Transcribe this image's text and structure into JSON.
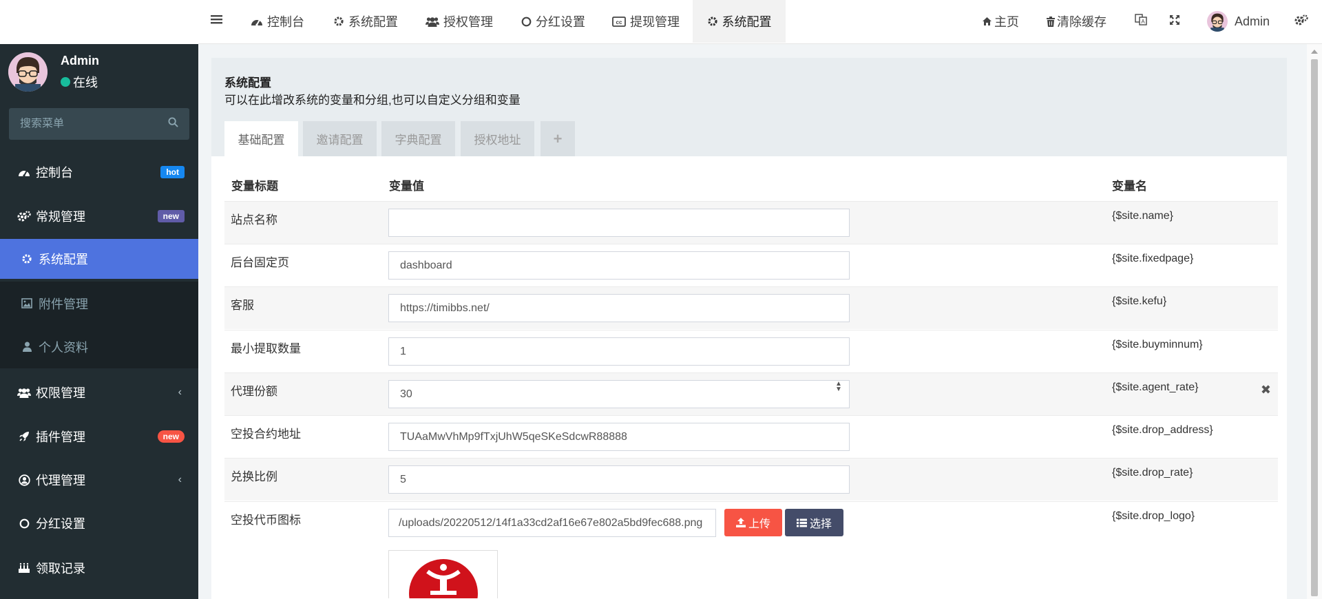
{
  "sidebar": {
    "user": {
      "name": "Admin",
      "status": "在线"
    },
    "search_placeholder": "搜索菜单",
    "items": [
      {
        "label": "控制台",
        "icon": "dashboard-icon",
        "badge": "hot"
      },
      {
        "label": "常规管理",
        "icon": "cogs-icon",
        "badge": "new"
      },
      {
        "label": "系统配置",
        "icon": "gear-icon"
      },
      {
        "label": "附件管理",
        "icon": "image-icon"
      },
      {
        "label": "个人资料",
        "icon": "user-icon"
      },
      {
        "label": "权限管理",
        "icon": "users-icon"
      },
      {
        "label": "插件管理",
        "icon": "rocket-icon",
        "badge": "new"
      },
      {
        "label": "代理管理",
        "icon": "user-circle-icon"
      },
      {
        "label": "分红设置",
        "icon": "circle-icon"
      },
      {
        "label": "领取记录",
        "icon": "birthday-cake-icon"
      }
    ]
  },
  "topnav": {
    "tabs": [
      {
        "label": "控制台",
        "icon": "dashboard-icon"
      },
      {
        "label": "系统配置",
        "icon": "gear-icon"
      },
      {
        "label": "授权管理",
        "icon": "users-icon"
      },
      {
        "label": "分红设置",
        "icon": "circle-icon"
      },
      {
        "label": "提现管理",
        "icon": "cc-icon"
      },
      {
        "label": "系统配置",
        "icon": "gear-icon"
      }
    ],
    "home": "主页",
    "clear_cache": "清除缓存",
    "user": "Admin"
  },
  "panel": {
    "title": "系统配置",
    "description": "可以在此增改系统的变量和分组,也可以自定义分组和变量",
    "tabs": [
      "基础配置",
      "邀请配置",
      "字典配置",
      "授权地址"
    ],
    "add_tab": "+",
    "columns": {
      "title": "变量标题",
      "value": "变量值",
      "name": "变量名"
    },
    "rows": [
      {
        "label": "站点名称",
        "value": "",
        "var": "{$site.name}"
      },
      {
        "label": "后台固定页",
        "value": "dashboard",
        "var": "{$site.fixedpage}"
      },
      {
        "label": "客服",
        "value": "https://timibbs.net/",
        "var": "{$site.kefu}"
      },
      {
        "label": "最小提取数量",
        "value": "1",
        "var": "{$site.buyminnum}"
      },
      {
        "label": "代理份额",
        "value": "30",
        "var": "{$site.agent_rate}"
      },
      {
        "label": "空投合约地址",
        "value": "TUAaMwVhMp9fTxjUhW5qeSKeSdcwR88888",
        "var": "{$site.drop_address}"
      },
      {
        "label": "兑换比例",
        "value": "5",
        "var": "{$site.drop_rate}"
      },
      {
        "label": "空投代币图标",
        "value": "/uploads/20220512/14f1a33cd2af16e67e802a5bd9fec688.png",
        "var": "{$site.drop_logo}"
      }
    ],
    "upload_label": "上传",
    "select_label": "选择"
  },
  "colors": {
    "sidebar_bg": "#222d32",
    "active_menu": "#4e73df",
    "badge_hot": "#1688f1",
    "badge_new_purple": "#605ca8",
    "badge_new_red": "#f75444",
    "upload_button": "#f75444",
    "select_button": "#444c69",
    "status_online": "#18bc9c"
  }
}
